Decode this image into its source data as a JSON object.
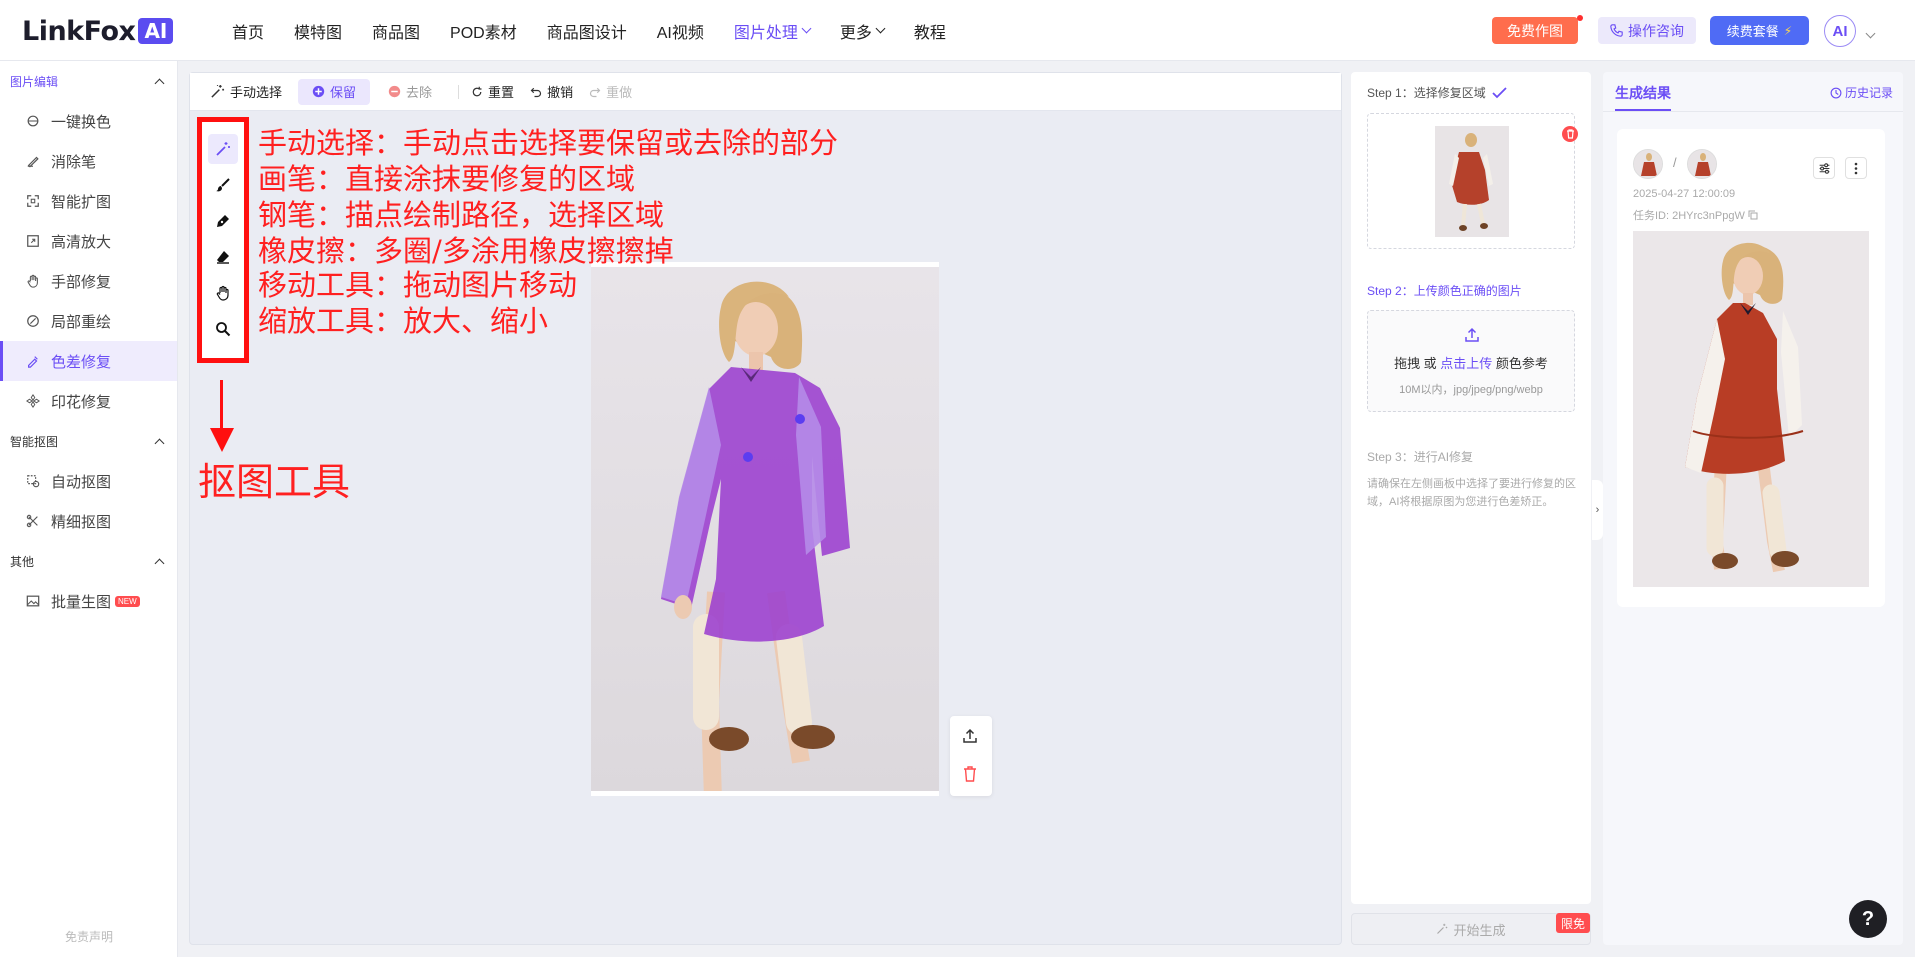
{
  "logo": {
    "name": "LinkFox",
    "badge": "AI"
  },
  "nav": [
    {
      "label": "首页",
      "active": false,
      "dropdown": false
    },
    {
      "label": "模特图",
      "active": false,
      "dropdown": false
    },
    {
      "label": "商品图",
      "active": false,
      "dropdown": false
    },
    {
      "label": "POD素材",
      "active": false,
      "dropdown": false
    },
    {
      "label": "商品图设计",
      "active": false,
      "dropdown": false
    },
    {
      "label": "AI视频",
      "active": false,
      "dropdown": false
    },
    {
      "label": "图片处理",
      "active": true,
      "dropdown": true
    },
    {
      "label": "更多",
      "active": false,
      "dropdown": true
    },
    {
      "label": "教程",
      "active": false,
      "dropdown": false
    }
  ],
  "header": {
    "free_label": "免费作图",
    "consult_label": "操作咨询",
    "renew_label": "续费套餐",
    "avatar_text": "AI"
  },
  "sidebar": {
    "sections": [
      {
        "title": "图片编辑",
        "items": [
          {
            "label": "一键换色",
            "icon": "color-swap-icon"
          },
          {
            "label": "消除笔",
            "icon": "eraser-pen-icon"
          },
          {
            "label": "智能扩图",
            "icon": "expand-icon"
          },
          {
            "label": "高清放大",
            "icon": "upscale-icon"
          },
          {
            "label": "手部修复",
            "icon": "hand-icon"
          },
          {
            "label": "局部重绘",
            "icon": "brush-icon"
          },
          {
            "label": "色差修复",
            "icon": "palette-icon",
            "active": true
          },
          {
            "label": "印花修复",
            "icon": "pattern-icon"
          }
        ]
      },
      {
        "title": "智能抠图",
        "items": [
          {
            "label": "自动抠图",
            "icon": "auto-cutout-icon"
          },
          {
            "label": "精细抠图",
            "icon": "fine-cutout-icon"
          }
        ]
      },
      {
        "title": "其他",
        "items": [
          {
            "label": "批量生图",
            "icon": "image-icon",
            "badge": "NEW"
          }
        ]
      }
    ],
    "disclaimer": "免责声明"
  },
  "toolbar": {
    "manual_select": "手动选择",
    "keep": "保留",
    "remove": "去除",
    "reset": "重置",
    "undo": "撤销",
    "redo": "重做"
  },
  "annotations": {
    "lines": [
      "手动选择：手动点击选择要保留或去除的部分",
      "画笔：直接涂抹要修复的区域",
      "钢笔：描点绘制路径，选择区域",
      "橡皮擦：多圈/多涂用橡皮擦擦掉",
      "移动工具：拖动图片移动",
      "缩放工具：放大、缩小"
    ],
    "toolbox_label": "抠图工具"
  },
  "steps": {
    "step1_title": "Step 1：选择修复区域",
    "step2_title": "Step 2：上传颜色正确的图片",
    "upload_drag": "拖拽 或 ",
    "upload_click": "点击上传",
    "upload_after": " 颜色参考",
    "upload_hint": "10M以内，jpg/jpeg/png/webp",
    "step3_title": "Step 3：进行AI修复",
    "step3_desc": "请确保在左侧画板中选择了要进行修复的区域，AI将根据原图为您进行色差矫正。",
    "generate_label": "开始生成",
    "generate_badge": "限免"
  },
  "results": {
    "tab": "生成结果",
    "history": "历史记录",
    "date": "2025-04-27 12:00:09",
    "task_id": "任务ID: 2HYrc3nPpgW",
    "slash": "/"
  },
  "colors": {
    "accent": "#6b4ef5",
    "annotation": "#ff1010",
    "selection_overlay": "#9b4dff"
  }
}
